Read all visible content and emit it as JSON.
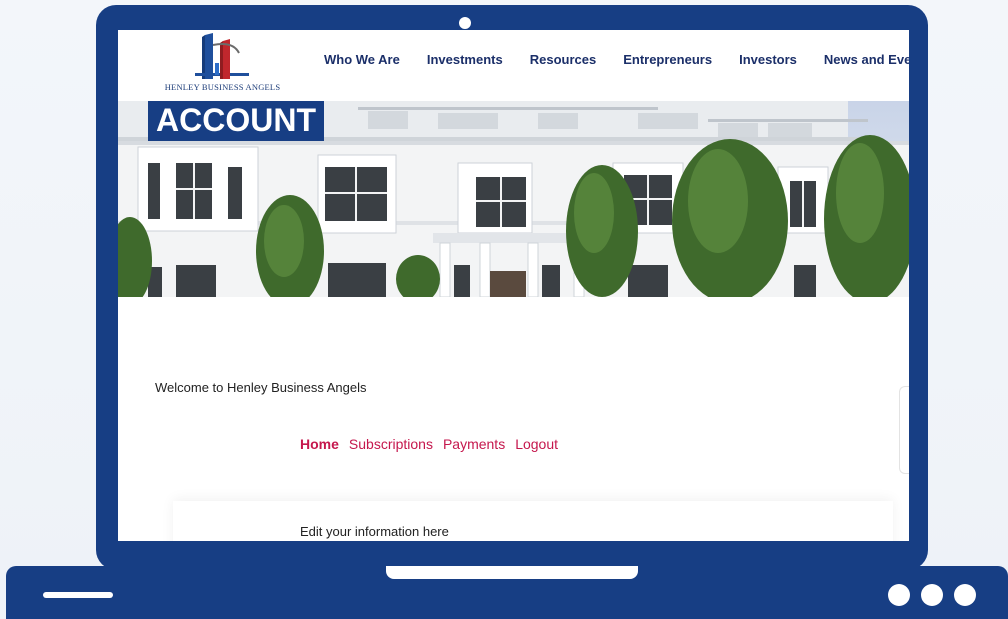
{
  "logo": {
    "text": "HENLEY BUSINESS ANGELS"
  },
  "nav": {
    "items": [
      {
        "label": "Who We Are"
      },
      {
        "label": "Investments"
      },
      {
        "label": "Resources"
      },
      {
        "label": "Entrepreneurs"
      },
      {
        "label": "Investors"
      },
      {
        "label": "News and Ever"
      }
    ]
  },
  "hero": {
    "title": "ACCOUNT"
  },
  "main": {
    "welcome": "Welcome to Henley Business Angels",
    "account_nav": [
      {
        "label": "Home",
        "active": true
      },
      {
        "label": "Subscriptions"
      },
      {
        "label": "Payments"
      },
      {
        "label": "Logout"
      }
    ],
    "edit_info": "Edit your information here"
  },
  "colors": {
    "frame": "#173e84",
    "nav_text": "#1b2f69",
    "account_link": "#c5174d",
    "logo_red": "#c0272d"
  }
}
